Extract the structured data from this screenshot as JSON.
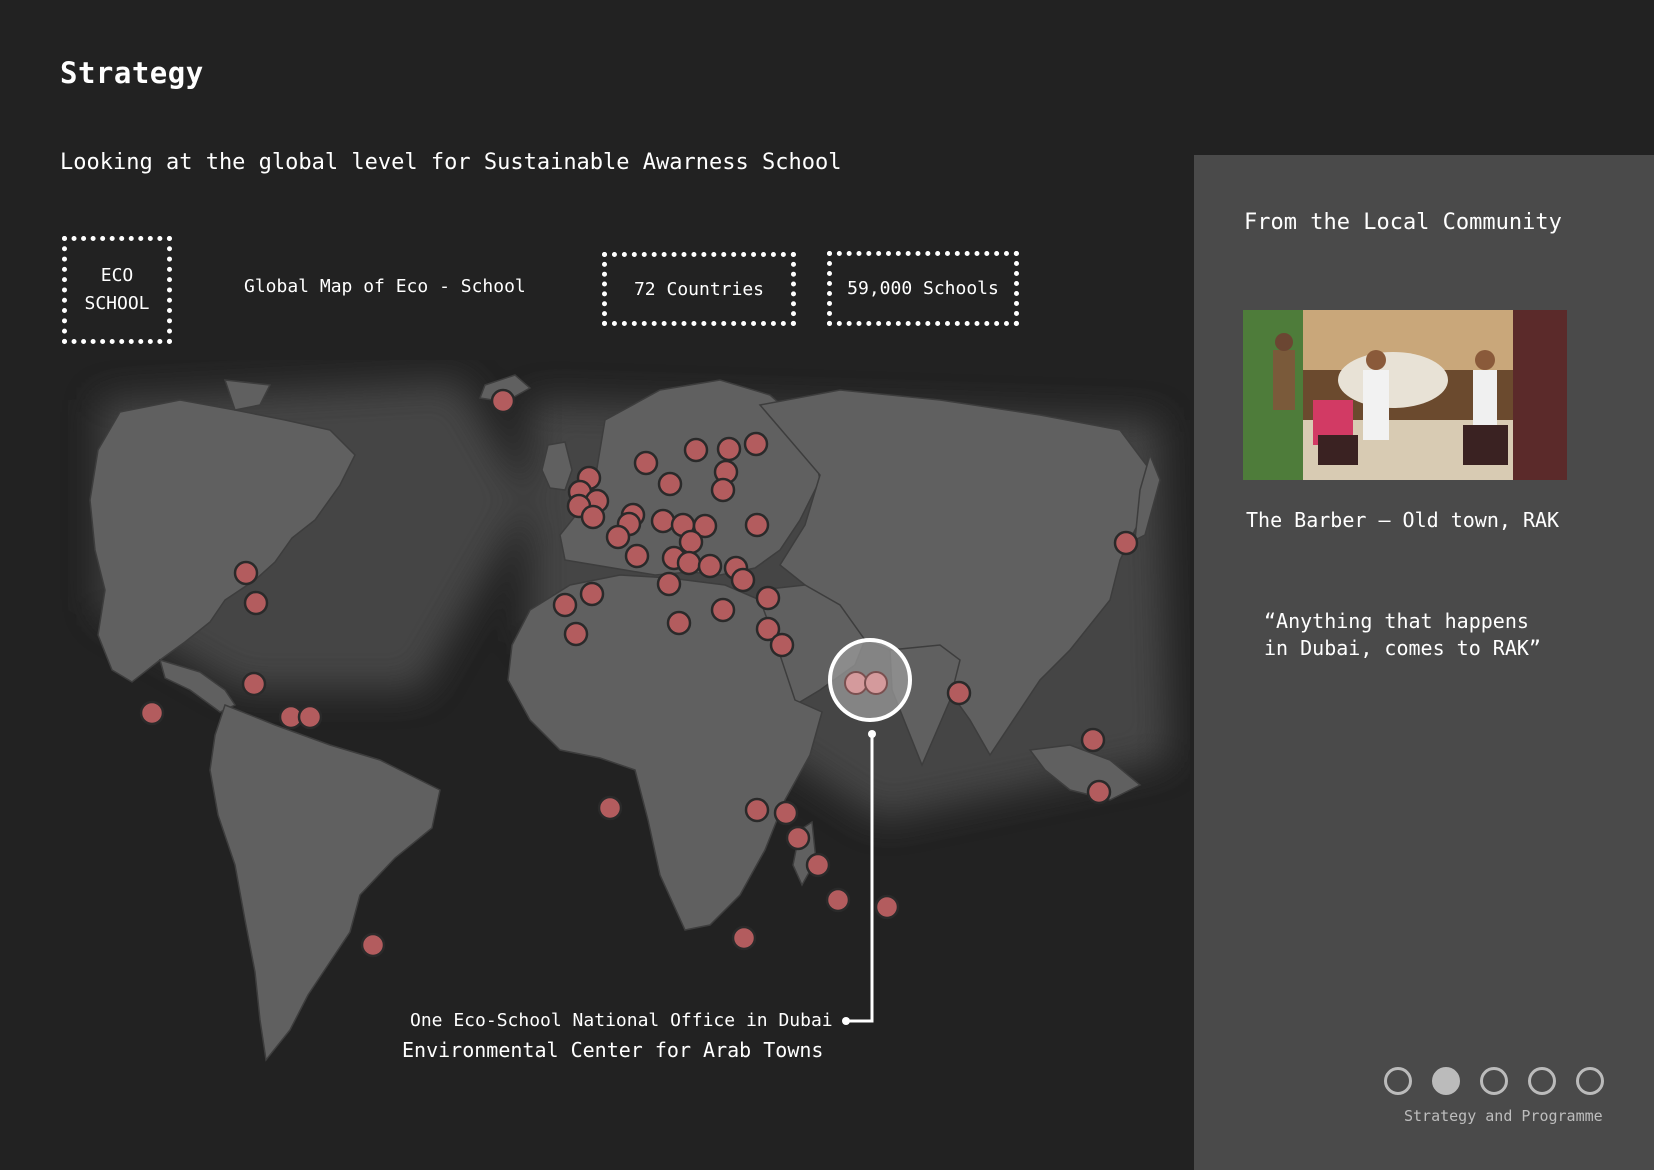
{
  "title": "Strategy",
  "subtitle": "Looking at the global level for Sustainable Awarness School",
  "eco_box": {
    "line1": "ECO",
    "line2": "SCHOOL"
  },
  "map_label": "Global Map of Eco - School",
  "stats": {
    "countries": "72 Countries",
    "schools": "59,000 Schools"
  },
  "office_note": {
    "line1": "One Eco-School National Office in Dubai",
    "line2": "Environmental Center for Arab Towns"
  },
  "side_panel": {
    "title": "From the Local Community",
    "photo_caption": "The Barber – Old town, RAK",
    "quote_line1": "“Anything that happens",
    "quote_line2": "in Dubai, comes to RAK”"
  },
  "pager": {
    "total": 5,
    "active_index": 1,
    "label": "Strategy and Programme"
  },
  "colors": {
    "background": "#222222",
    "panel": "#4a4a4a",
    "land": "#606060",
    "marker": "#b35c5e",
    "text": "#ffffff"
  }
}
